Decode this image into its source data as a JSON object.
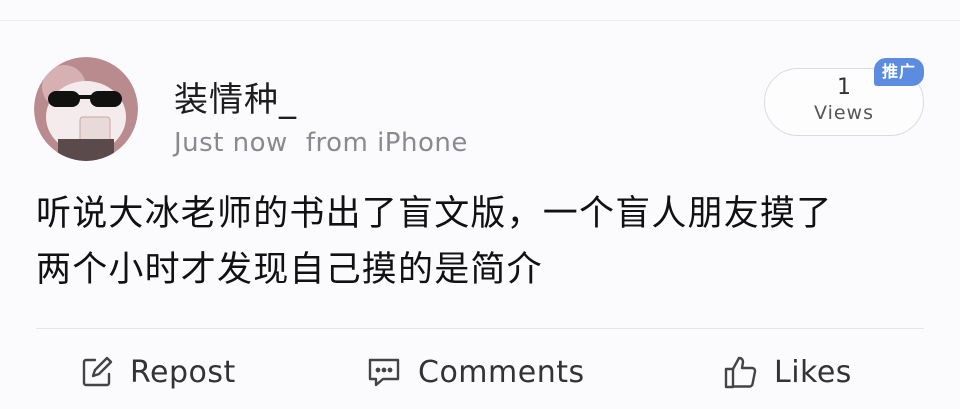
{
  "post": {
    "username": "装情种_",
    "time": "Just now",
    "source": "from iPhone",
    "views_count": "1",
    "views_label": "Views",
    "ad_tag": "推广",
    "text_line1": "听说大冰老师的书出了盲文版，一个盲人朋友摸了",
    "text_line2": "两个小时才发现自己摸的是简介"
  },
  "actions": {
    "repost": "Repost",
    "comments": "Comments",
    "likes": "Likes"
  },
  "icons": {
    "repost": "edit-square-icon",
    "comments": "comment-bubble-icon",
    "likes": "thumbs-up-icon"
  },
  "colors": {
    "ad_tag": "#5b8ce0",
    "meta_text": "#8a8a8e",
    "background": "#fbfbfd"
  }
}
